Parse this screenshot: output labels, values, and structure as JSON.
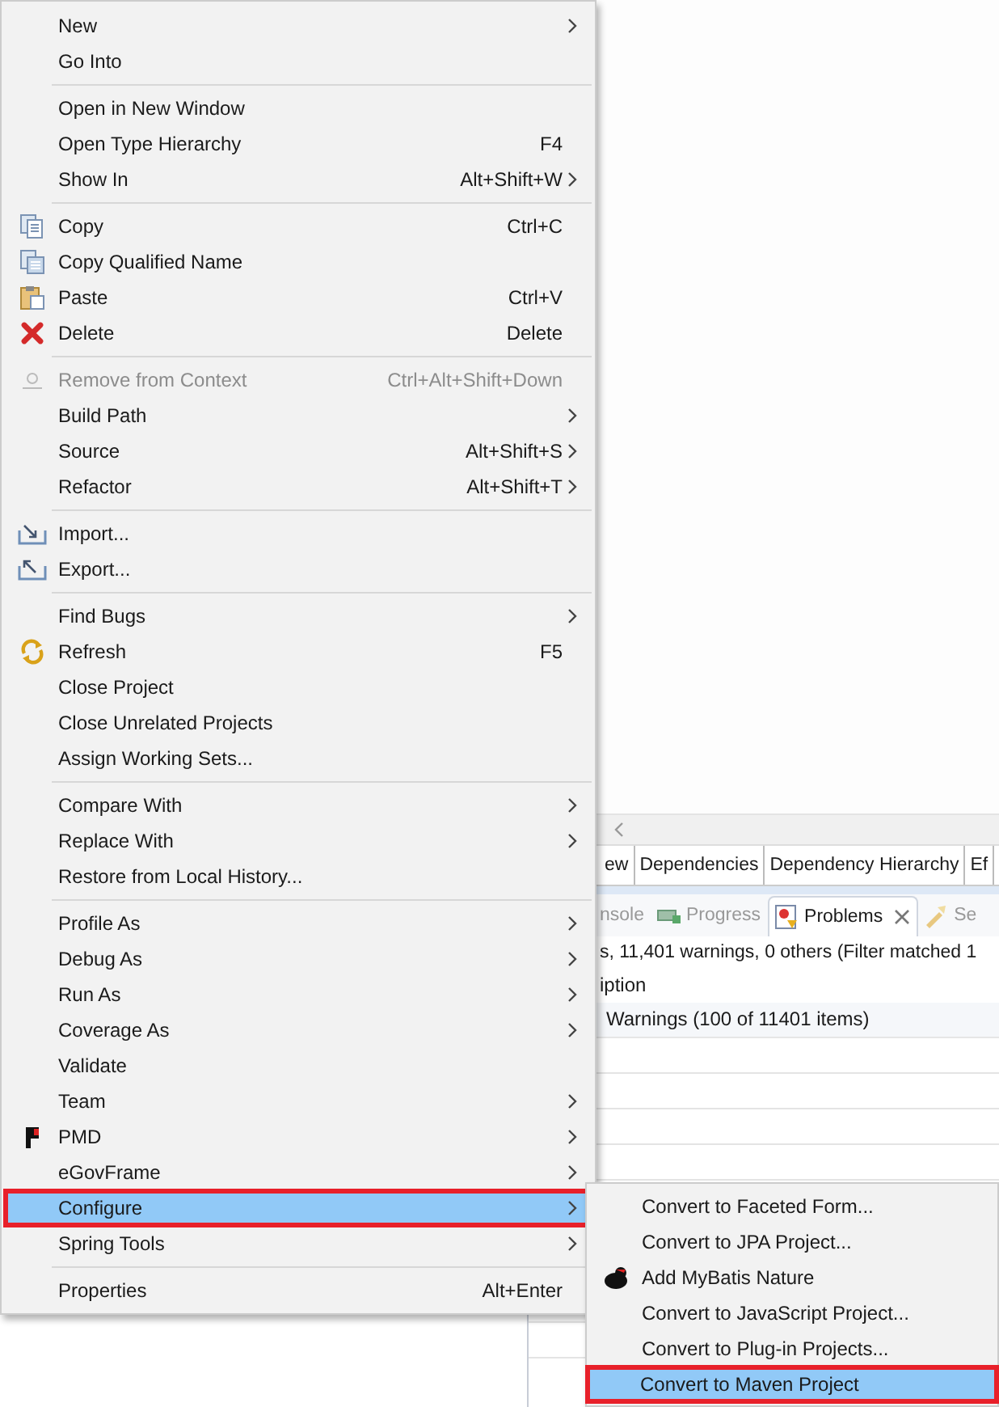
{
  "context_menu": {
    "items": [
      {
        "kind": "item",
        "label": "New",
        "submenu": true,
        "disabled": false,
        "selected": false,
        "annotated": false
      },
      {
        "kind": "item",
        "label": "Go Into",
        "submenu": false,
        "disabled": false,
        "selected": false,
        "annotated": false
      },
      {
        "kind": "separator"
      },
      {
        "kind": "item",
        "label": "Open in New Window",
        "submenu": false,
        "disabled": false,
        "selected": false,
        "annotated": false
      },
      {
        "kind": "item",
        "label": "Open Type Hierarchy",
        "shortcut": "F4",
        "submenu": false,
        "disabled": false,
        "selected": false,
        "annotated": false
      },
      {
        "kind": "item",
        "label": "Show In",
        "shortcut": "Alt+Shift+W",
        "submenu": true,
        "disabled": false,
        "selected": false,
        "annotated": false
      },
      {
        "kind": "separator"
      },
      {
        "kind": "copy",
        "label": "Copy",
        "shortcut": "Ctrl+C",
        "submenu": false,
        "disabled": false,
        "selected": false,
        "annotated": false
      },
      {
        "kind": "qualified",
        "label": "Copy Qualified Name",
        "submenu": false,
        "disabled": false,
        "selected": false,
        "annotated": false
      },
      {
        "kind": "paste",
        "label": "Paste",
        "shortcut": "Ctrl+V",
        "submenu": false,
        "disabled": false,
        "selected": false,
        "annotated": false
      },
      {
        "kind": "delete",
        "label": "Delete",
        "shortcut": "Delete",
        "submenu": false,
        "disabled": false,
        "selected": false,
        "annotated": false
      },
      {
        "kind": "separator"
      },
      {
        "kind": "remove",
        "label": "Remove from Context",
        "shortcut": "Ctrl+Alt+Shift+Down",
        "submenu": false,
        "disabled": true,
        "selected": false,
        "annotated": false
      },
      {
        "kind": "item",
        "label": "Build Path",
        "submenu": true,
        "disabled": false,
        "selected": false,
        "annotated": false
      },
      {
        "kind": "item",
        "label": "Source",
        "shortcut": "Alt+Shift+S",
        "submenu": true,
        "disabled": false,
        "selected": false,
        "annotated": false
      },
      {
        "kind": "item",
        "label": "Refactor",
        "shortcut": "Alt+Shift+T",
        "submenu": true,
        "disabled": false,
        "selected": false,
        "annotated": false
      },
      {
        "kind": "separator"
      },
      {
        "kind": "import",
        "label": "Import...",
        "submenu": false,
        "disabled": false,
        "selected": false,
        "annotated": false
      },
      {
        "kind": "export",
        "label": "Export...",
        "submenu": false,
        "disabled": false,
        "selected": false,
        "annotated": false
      },
      {
        "kind": "separator"
      },
      {
        "kind": "item",
        "label": "Find Bugs",
        "submenu": true,
        "disabled": false,
        "selected": false,
        "annotated": false
      },
      {
        "kind": "refresh",
        "label": "Refresh",
        "shortcut": "F5",
        "submenu": false,
        "disabled": false,
        "selected": false,
        "annotated": false
      },
      {
        "kind": "item",
        "label": "Close Project",
        "submenu": false,
        "disabled": false,
        "selected": false,
        "annotated": false
      },
      {
        "kind": "item",
        "label": "Close Unrelated Projects",
        "submenu": false,
        "disabled": false,
        "selected": false,
        "annotated": false
      },
      {
        "kind": "item",
        "label": "Assign Working Sets...",
        "submenu": false,
        "disabled": false,
        "selected": false,
        "annotated": false
      },
      {
        "kind": "separator"
      },
      {
        "kind": "item",
        "label": "Compare With",
        "submenu": true,
        "disabled": false,
        "selected": false,
        "annotated": false
      },
      {
        "kind": "item",
        "label": "Replace With",
        "submenu": true,
        "disabled": false,
        "selected": false,
        "annotated": false
      },
      {
        "kind": "item",
        "label": "Restore from Local History...",
        "submenu": false,
        "disabled": false,
        "selected": false,
        "annotated": false
      },
      {
        "kind": "separator"
      },
      {
        "kind": "item",
        "label": "Profile As",
        "submenu": true,
        "disabled": false,
        "selected": false,
        "annotated": false
      },
      {
        "kind": "item",
        "label": "Debug As",
        "submenu": true,
        "disabled": false,
        "selected": false,
        "annotated": false
      },
      {
        "kind": "item",
        "label": "Run As",
        "submenu": true,
        "disabled": false,
        "selected": false,
        "annotated": false
      },
      {
        "kind": "item",
        "label": "Coverage As",
        "submenu": true,
        "disabled": false,
        "selected": false,
        "annotated": false
      },
      {
        "kind": "item",
        "label": "Validate",
        "submenu": false,
        "disabled": false,
        "selected": false,
        "annotated": false
      },
      {
        "kind": "item",
        "label": "Team",
        "submenu": true,
        "disabled": false,
        "selected": false,
        "annotated": false
      },
      {
        "kind": "pmd",
        "label": "PMD",
        "submenu": true,
        "disabled": false,
        "selected": false,
        "annotated": false
      },
      {
        "kind": "item",
        "label": "eGovFrame",
        "submenu": true,
        "disabled": false,
        "selected": false,
        "annotated": false
      },
      {
        "kind": "item",
        "label": "Configure",
        "submenu": true,
        "disabled": false,
        "selected": true,
        "annotated": true
      },
      {
        "kind": "item",
        "label": "Spring Tools",
        "submenu": true,
        "disabled": false,
        "selected": false,
        "annotated": false
      },
      {
        "kind": "separator"
      },
      {
        "kind": "item",
        "label": "Properties",
        "shortcut": "Alt+Enter",
        "submenu": false,
        "disabled": false,
        "selected": false,
        "annotated": false
      }
    ]
  },
  "submenu": {
    "items": [
      {
        "kind": "plain",
        "label": "Convert to Faceted Form...",
        "selected": false,
        "annotated": false
      },
      {
        "kind": "plain",
        "label": "Convert to JPA Project...",
        "selected": false,
        "annotated": false
      },
      {
        "kind": "mybatis",
        "label": "Add MyBatis Nature",
        "selected": false,
        "annotated": false
      },
      {
        "kind": "plain",
        "label": "Convert to JavaScript Project...",
        "selected": false,
        "annotated": false
      },
      {
        "kind": "plain",
        "label": "Convert to Plug-in Projects...",
        "selected": false,
        "annotated": false
      },
      {
        "kind": "plain",
        "label": "Convert to Maven Project",
        "selected": true,
        "annotated": true
      }
    ]
  },
  "editor_tabs": [
    {
      "label": "ew"
    },
    {
      "label": "Dependencies"
    },
    {
      "label": "Dependency Hierarchy"
    },
    {
      "label": "Ef"
    }
  ],
  "view_tabs": [
    {
      "kind": "plain",
      "label": "nsole",
      "selected": false,
      "closable": false
    },
    {
      "kind": "progress",
      "label": "Progress",
      "selected": false,
      "closable": false
    },
    {
      "kind": "problems",
      "label": "Problems",
      "selected": true,
      "closable": true
    },
    {
      "kind": "search",
      "label": "Se",
      "selected": false,
      "closable": false
    }
  ],
  "problems": {
    "summary": "s, 11,401 warnings, 0 others (Filter matched 1",
    "column_1": "iption",
    "rows": [
      {
        "label": "Warnings (100 of 11401 items)"
      }
    ]
  }
}
